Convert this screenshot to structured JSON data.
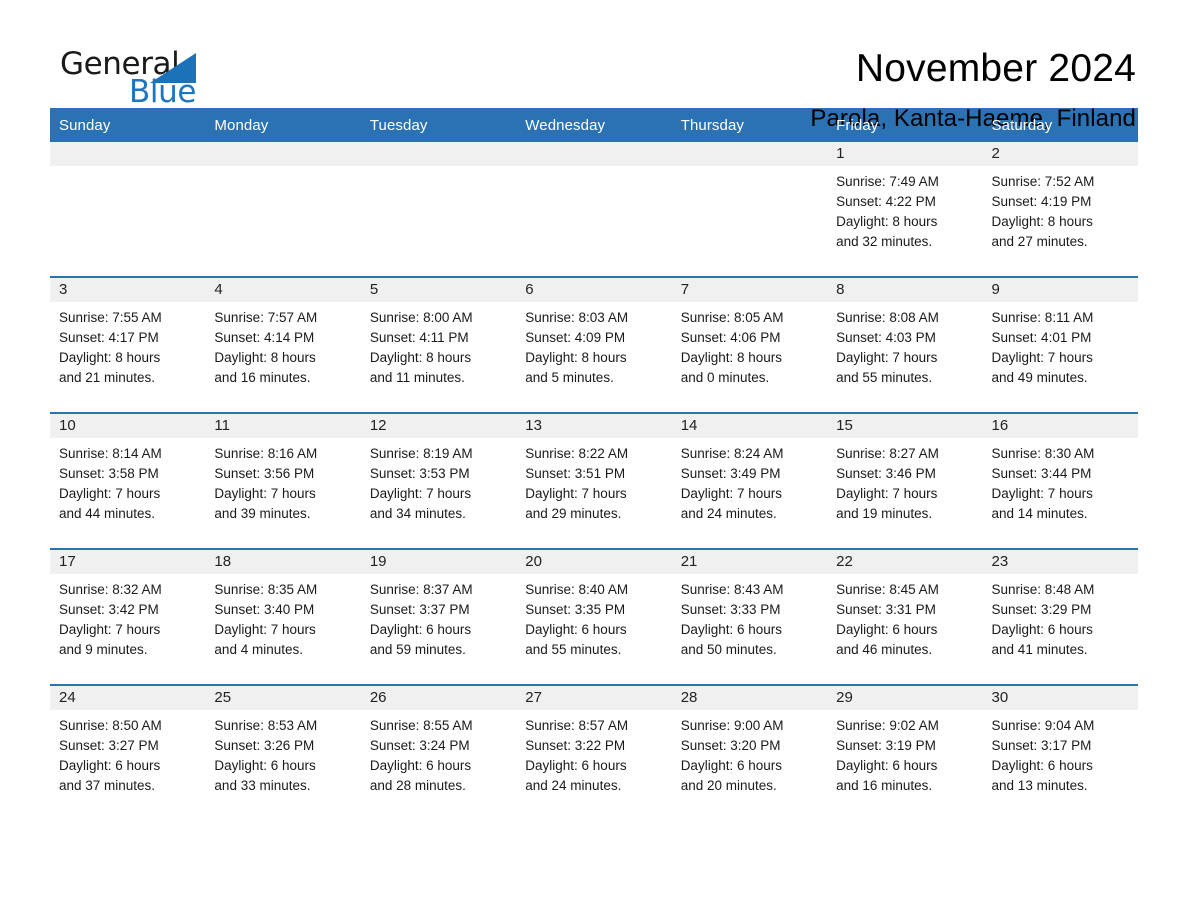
{
  "brand": {
    "name_part1": "General",
    "name_part2": "Blue",
    "logo_icon": "triangle-icon"
  },
  "header": {
    "title": "November 2024",
    "subtitle": "Parola, Kanta-Haeme, Finland"
  },
  "colors": {
    "header_blue": "#2b72b4",
    "brand_blue": "#1f76bd",
    "day_band_gray": "#f0f0f0",
    "page_background": "#ffffff"
  },
  "weekday_headers": [
    "Sunday",
    "Monday",
    "Tuesday",
    "Wednesday",
    "Thursday",
    "Friday",
    "Saturday"
  ],
  "weeks": [
    [
      {
        "day": "",
        "sunrise": "",
        "sunset": "",
        "daylight_line1": "",
        "daylight_line2": "",
        "empty": true
      },
      {
        "day": "",
        "sunrise": "",
        "sunset": "",
        "daylight_line1": "",
        "daylight_line2": "",
        "empty": true
      },
      {
        "day": "",
        "sunrise": "",
        "sunset": "",
        "daylight_line1": "",
        "daylight_line2": "",
        "empty": true
      },
      {
        "day": "",
        "sunrise": "",
        "sunset": "",
        "daylight_line1": "",
        "daylight_line2": "",
        "empty": true
      },
      {
        "day": "",
        "sunrise": "",
        "sunset": "",
        "daylight_line1": "",
        "daylight_line2": "",
        "empty": true
      },
      {
        "day": "1",
        "sunrise": "Sunrise: 7:49 AM",
        "sunset": "Sunset: 4:22 PM",
        "daylight_line1": "Daylight: 8 hours",
        "daylight_line2": "and 32 minutes.",
        "empty": false
      },
      {
        "day": "2",
        "sunrise": "Sunrise: 7:52 AM",
        "sunset": "Sunset: 4:19 PM",
        "daylight_line1": "Daylight: 8 hours",
        "daylight_line2": "and 27 minutes.",
        "empty": false
      }
    ],
    [
      {
        "day": "3",
        "sunrise": "Sunrise: 7:55 AM",
        "sunset": "Sunset: 4:17 PM",
        "daylight_line1": "Daylight: 8 hours",
        "daylight_line2": "and 21 minutes.",
        "empty": false
      },
      {
        "day": "4",
        "sunrise": "Sunrise: 7:57 AM",
        "sunset": "Sunset: 4:14 PM",
        "daylight_line1": "Daylight: 8 hours",
        "daylight_line2": "and 16 minutes.",
        "empty": false
      },
      {
        "day": "5",
        "sunrise": "Sunrise: 8:00 AM",
        "sunset": "Sunset: 4:11 PM",
        "daylight_line1": "Daylight: 8 hours",
        "daylight_line2": "and 11 minutes.",
        "empty": false
      },
      {
        "day": "6",
        "sunrise": "Sunrise: 8:03 AM",
        "sunset": "Sunset: 4:09 PM",
        "daylight_line1": "Daylight: 8 hours",
        "daylight_line2": "and 5 minutes.",
        "empty": false
      },
      {
        "day": "7",
        "sunrise": "Sunrise: 8:05 AM",
        "sunset": "Sunset: 4:06 PM",
        "daylight_line1": "Daylight: 8 hours",
        "daylight_line2": "and 0 minutes.",
        "empty": false
      },
      {
        "day": "8",
        "sunrise": "Sunrise: 8:08 AM",
        "sunset": "Sunset: 4:03 PM",
        "daylight_line1": "Daylight: 7 hours",
        "daylight_line2": "and 55 minutes.",
        "empty": false
      },
      {
        "day": "9",
        "sunrise": "Sunrise: 8:11 AM",
        "sunset": "Sunset: 4:01 PM",
        "daylight_line1": "Daylight: 7 hours",
        "daylight_line2": "and 49 minutes.",
        "empty": false
      }
    ],
    [
      {
        "day": "10",
        "sunrise": "Sunrise: 8:14 AM",
        "sunset": "Sunset: 3:58 PM",
        "daylight_line1": "Daylight: 7 hours",
        "daylight_line2": "and 44 minutes.",
        "empty": false
      },
      {
        "day": "11",
        "sunrise": "Sunrise: 8:16 AM",
        "sunset": "Sunset: 3:56 PM",
        "daylight_line1": "Daylight: 7 hours",
        "daylight_line2": "and 39 minutes.",
        "empty": false
      },
      {
        "day": "12",
        "sunrise": "Sunrise: 8:19 AM",
        "sunset": "Sunset: 3:53 PM",
        "daylight_line1": "Daylight: 7 hours",
        "daylight_line2": "and 34 minutes.",
        "empty": false
      },
      {
        "day": "13",
        "sunrise": "Sunrise: 8:22 AM",
        "sunset": "Sunset: 3:51 PM",
        "daylight_line1": "Daylight: 7 hours",
        "daylight_line2": "and 29 minutes.",
        "empty": false
      },
      {
        "day": "14",
        "sunrise": "Sunrise: 8:24 AM",
        "sunset": "Sunset: 3:49 PM",
        "daylight_line1": "Daylight: 7 hours",
        "daylight_line2": "and 24 minutes.",
        "empty": false
      },
      {
        "day": "15",
        "sunrise": "Sunrise: 8:27 AM",
        "sunset": "Sunset: 3:46 PM",
        "daylight_line1": "Daylight: 7 hours",
        "daylight_line2": "and 19 minutes.",
        "empty": false
      },
      {
        "day": "16",
        "sunrise": "Sunrise: 8:30 AM",
        "sunset": "Sunset: 3:44 PM",
        "daylight_line1": "Daylight: 7 hours",
        "daylight_line2": "and 14 minutes.",
        "empty": false
      }
    ],
    [
      {
        "day": "17",
        "sunrise": "Sunrise: 8:32 AM",
        "sunset": "Sunset: 3:42 PM",
        "daylight_line1": "Daylight: 7 hours",
        "daylight_line2": "and 9 minutes.",
        "empty": false
      },
      {
        "day": "18",
        "sunrise": "Sunrise: 8:35 AM",
        "sunset": "Sunset: 3:40 PM",
        "daylight_line1": "Daylight: 7 hours",
        "daylight_line2": "and 4 minutes.",
        "empty": false
      },
      {
        "day": "19",
        "sunrise": "Sunrise: 8:37 AM",
        "sunset": "Sunset: 3:37 PM",
        "daylight_line1": "Daylight: 6 hours",
        "daylight_line2": "and 59 minutes.",
        "empty": false
      },
      {
        "day": "20",
        "sunrise": "Sunrise: 8:40 AM",
        "sunset": "Sunset: 3:35 PM",
        "daylight_line1": "Daylight: 6 hours",
        "daylight_line2": "and 55 minutes.",
        "empty": false
      },
      {
        "day": "21",
        "sunrise": "Sunrise: 8:43 AM",
        "sunset": "Sunset: 3:33 PM",
        "daylight_line1": "Daylight: 6 hours",
        "daylight_line2": "and 50 minutes.",
        "empty": false
      },
      {
        "day": "22",
        "sunrise": "Sunrise: 8:45 AM",
        "sunset": "Sunset: 3:31 PM",
        "daylight_line1": "Daylight: 6 hours",
        "daylight_line2": "and 46 minutes.",
        "empty": false
      },
      {
        "day": "23",
        "sunrise": "Sunrise: 8:48 AM",
        "sunset": "Sunset: 3:29 PM",
        "daylight_line1": "Daylight: 6 hours",
        "daylight_line2": "and 41 minutes.",
        "empty": false
      }
    ],
    [
      {
        "day": "24",
        "sunrise": "Sunrise: 8:50 AM",
        "sunset": "Sunset: 3:27 PM",
        "daylight_line1": "Daylight: 6 hours",
        "daylight_line2": "and 37 minutes.",
        "empty": false
      },
      {
        "day": "25",
        "sunrise": "Sunrise: 8:53 AM",
        "sunset": "Sunset: 3:26 PM",
        "daylight_line1": "Daylight: 6 hours",
        "daylight_line2": "and 33 minutes.",
        "empty": false
      },
      {
        "day": "26",
        "sunrise": "Sunrise: 8:55 AM",
        "sunset": "Sunset: 3:24 PM",
        "daylight_line1": "Daylight: 6 hours",
        "daylight_line2": "and 28 minutes.",
        "empty": false
      },
      {
        "day": "27",
        "sunrise": "Sunrise: 8:57 AM",
        "sunset": "Sunset: 3:22 PM",
        "daylight_line1": "Daylight: 6 hours",
        "daylight_line2": "and 24 minutes.",
        "empty": false
      },
      {
        "day": "28",
        "sunrise": "Sunrise: 9:00 AM",
        "sunset": "Sunset: 3:20 PM",
        "daylight_line1": "Daylight: 6 hours",
        "daylight_line2": "and 20 minutes.",
        "empty": false
      },
      {
        "day": "29",
        "sunrise": "Sunrise: 9:02 AM",
        "sunset": "Sunset: 3:19 PM",
        "daylight_line1": "Daylight: 6 hours",
        "daylight_line2": "and 16 minutes.",
        "empty": false
      },
      {
        "day": "30",
        "sunrise": "Sunrise: 9:04 AM",
        "sunset": "Sunset: 3:17 PM",
        "daylight_line1": "Daylight: 6 hours",
        "daylight_line2": "and 13 minutes.",
        "empty": false
      }
    ]
  ]
}
